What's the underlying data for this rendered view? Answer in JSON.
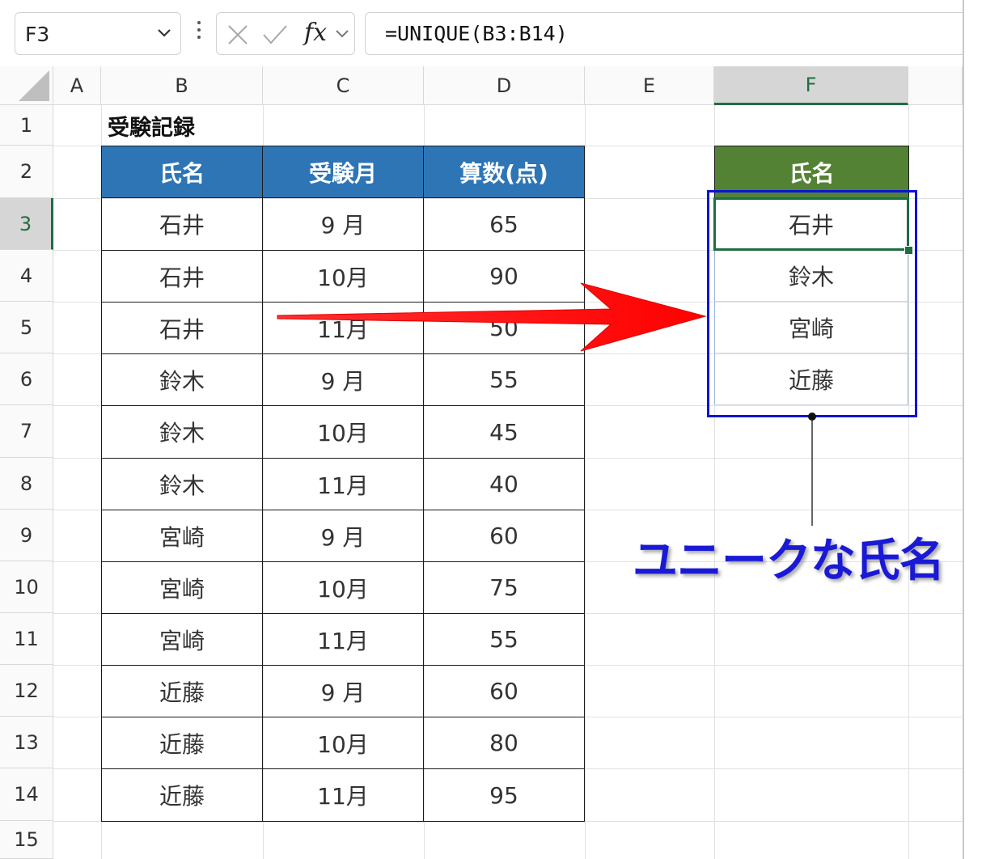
{
  "name_box": "F3",
  "formula": "=UNIQUE(B3:B14)",
  "fx_label": "fx",
  "columns": [
    "A",
    "B",
    "C",
    "D",
    "E",
    "F"
  ],
  "rows": [
    "1",
    "2",
    "3",
    "4",
    "5",
    "6",
    "7",
    "8",
    "9",
    "10",
    "11",
    "12",
    "13",
    "14",
    "15"
  ],
  "sheet": {
    "title": "受験記録",
    "headers": [
      "氏名",
      "受験月",
      "算数(点)"
    ],
    "records": [
      [
        "石井",
        "9 月",
        "65"
      ],
      [
        "石井",
        "10月",
        "90"
      ],
      [
        "石井",
        "11月",
        "50"
      ],
      [
        "鈴木",
        "9 月",
        "55"
      ],
      [
        "鈴木",
        "10月",
        "45"
      ],
      [
        "鈴木",
        "11月",
        "40"
      ],
      [
        "宮崎",
        "9 月",
        "60"
      ],
      [
        "宮崎",
        "10月",
        "75"
      ],
      [
        "宮崎",
        "11月",
        "55"
      ],
      [
        "近藤",
        "9 月",
        "60"
      ],
      [
        "近藤",
        "10月",
        "80"
      ],
      [
        "近藤",
        "11月",
        "95"
      ]
    ],
    "unique_header": "氏名",
    "unique_names": [
      "石井",
      "鈴木",
      "宮崎",
      "近藤"
    ]
  },
  "annotation": "ユニークな氏名",
  "active_cell": "F3",
  "colors": {
    "table_header": "#2e75b6",
    "unique_header": "#548235",
    "selection": "#1e6e42",
    "annotation": "#1a1ad6",
    "arrow": "#ff0000"
  }
}
